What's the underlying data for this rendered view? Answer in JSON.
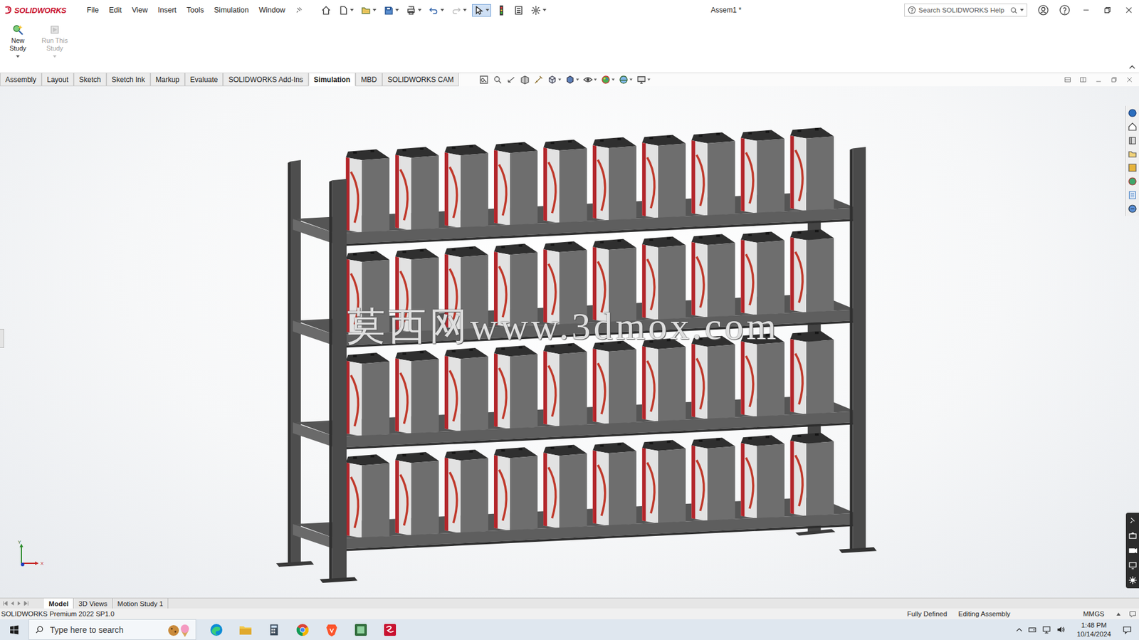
{
  "app": {
    "logo": "SOLIDWORKS",
    "document_title": "Assem1 *"
  },
  "menu": [
    "File",
    "Edit",
    "View",
    "Insert",
    "Tools",
    "Simulation",
    "Window"
  ],
  "search": {
    "placeholder": "Search SOLIDWORKS Help"
  },
  "ribbon": [
    {
      "label": "New Study",
      "disabled": false
    },
    {
      "label": "Run This Study",
      "disabled": true
    }
  ],
  "tabs": [
    {
      "label": "Assembly",
      "selected": false
    },
    {
      "label": "Layout",
      "selected": false
    },
    {
      "label": "Sketch",
      "selected": false
    },
    {
      "label": "Sketch Ink",
      "selected": false
    },
    {
      "label": "Markup",
      "selected": false
    },
    {
      "label": "Evaluate",
      "selected": false
    },
    {
      "label": "SOLIDWORKS Add-Ins",
      "selected": false
    },
    {
      "label": "Simulation",
      "selected": true
    },
    {
      "label": "MBD",
      "selected": false
    },
    {
      "label": "SOLIDWORKS CAM",
      "selected": false
    }
  ],
  "watermark": "莫西网www.3dmox.com",
  "model": {
    "shelves": 4,
    "batteries_per_shelf": 10
  },
  "triad": {
    "y": "Y",
    "x": "X"
  },
  "bottom_tabs": [
    {
      "label": "Model",
      "selected": true
    },
    {
      "label": "3D Views",
      "selected": false
    },
    {
      "label": "Motion Study 1",
      "selected": false
    }
  ],
  "status_bar": {
    "product": "SOLIDWORKS Premium 2022 SP1.0",
    "items": [
      "Fully Defined",
      "Editing Assembly",
      "MMGS"
    ]
  },
  "taskbar": {
    "search_placeholder": "Type here to search",
    "time": "1:48 PM",
    "date": "10/14/2024"
  }
}
